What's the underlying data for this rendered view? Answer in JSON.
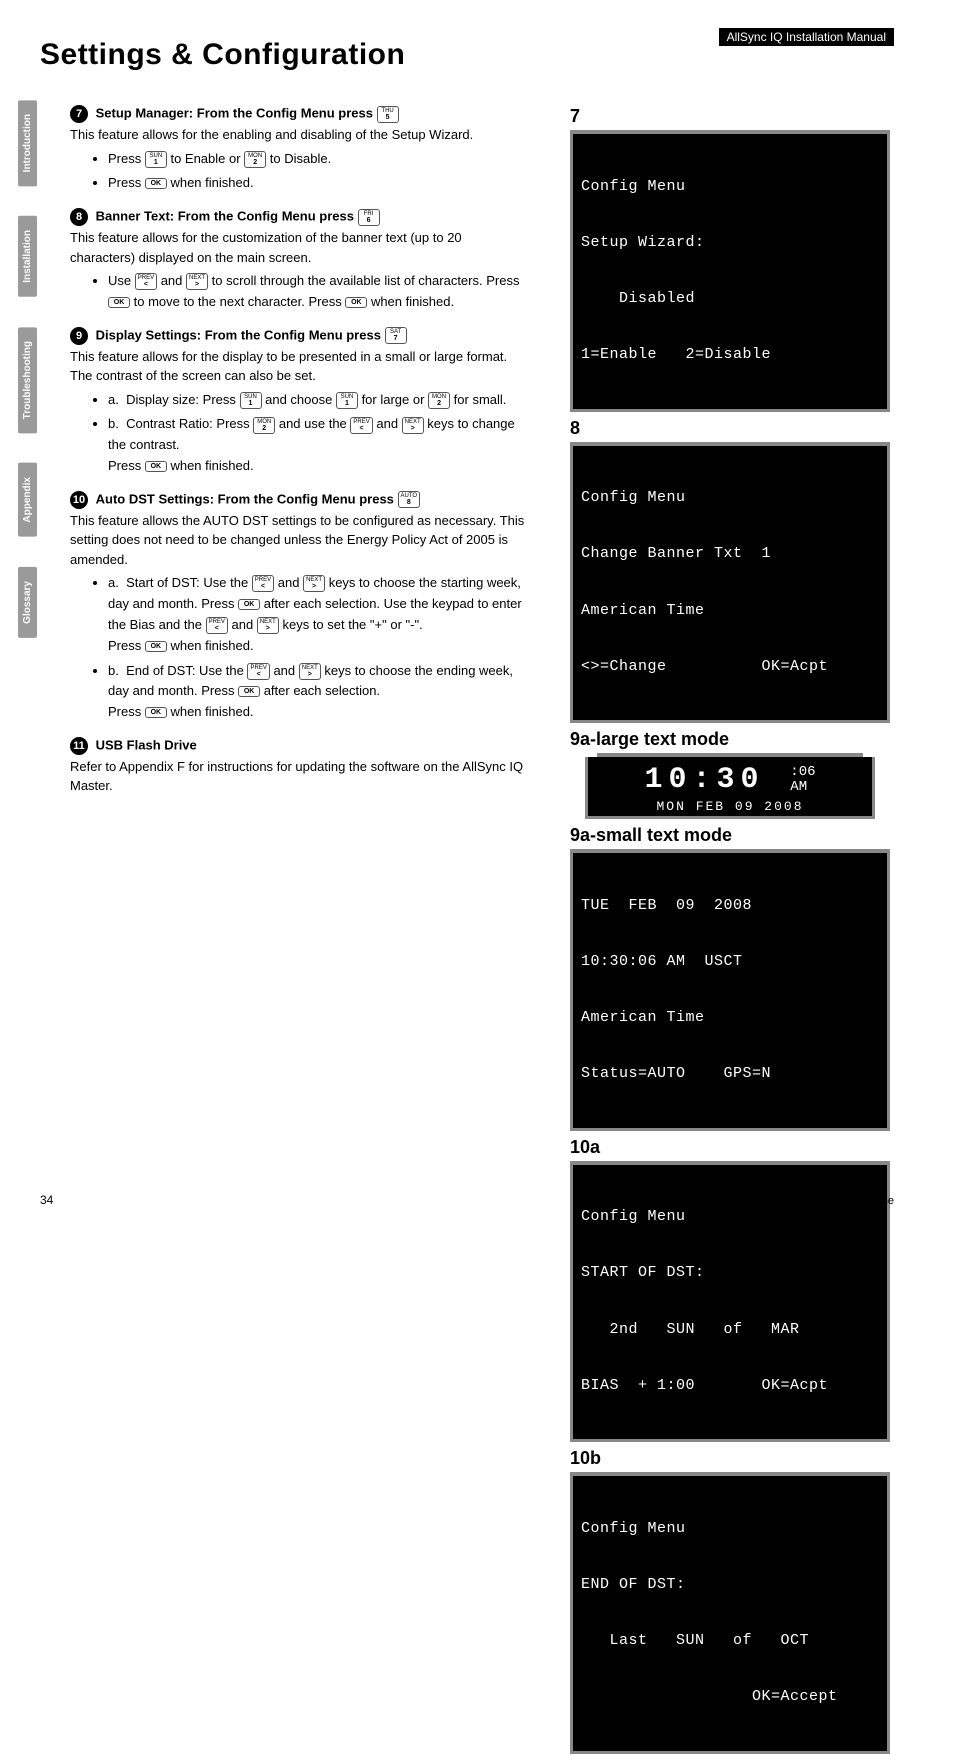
{
  "header_bar": "AllSync IQ Installation Manual",
  "page_title": "Settings & Configuration",
  "tabs": [
    "Introduction",
    "Installation",
    "Troubleshooting",
    "Appendix",
    "Glossary"
  ],
  "keys": {
    "thu5": {
      "top": "THU",
      "bot": "5"
    },
    "sun1": {
      "top": "SUN",
      "bot": "1"
    },
    "mon2": {
      "top": "MON",
      "bot": "2"
    },
    "ok": {
      "top": "",
      "bot": "OK"
    },
    "fri6": {
      "top": "FRI",
      "bot": "6"
    },
    "prev": {
      "top": "PREV",
      "bot": "<"
    },
    "next": {
      "top": "NEXT",
      "bot": ">"
    },
    "sat7": {
      "top": "SAT",
      "bot": "7"
    },
    "auto8": {
      "top": "AUTO",
      "bot": "8"
    }
  },
  "sections": {
    "s7": {
      "num": "7",
      "title": "Setup Manager: From the Config Menu press",
      "title_key": "thu5",
      "body": "This feature allows for the enabling and disabling of the Setup Wizard.",
      "bullets": [
        {
          "pre": "Press ",
          "k1": "sun1",
          "mid": " to Enable or ",
          "k2": "mon2",
          "post": " to Disable."
        },
        {
          "pre": "Press ",
          "k1": "ok",
          "post": " when finished."
        }
      ]
    },
    "s8": {
      "num": "8",
      "title": "Banner Text: From the Config Menu press",
      "title_key": "fri6",
      "body": "This feature allows for the customization of the banner text (up to 20 characters) displayed on the main screen.",
      "bullets": [
        {
          "pre": "Use ",
          "k1": "prev",
          "mid": " and ",
          "k2": "next",
          "post": " to scroll through the available list of characters. Press ",
          "k3": "ok",
          "post2": " to move to the next character. Press ",
          "k4": "ok",
          "post3": " when finished."
        }
      ]
    },
    "s9": {
      "num": "9",
      "title": "Display Settings: From the Config Menu press",
      "title_key": "sat7",
      "body": "This feature allows for the display to be presented in a small or large format. The contrast of the screen can also be set.",
      "bullets": [
        {
          "label": "a.",
          "pre": "Display size: Press ",
          "k1": "sun1",
          "mid": " and choose ",
          "k2": "sun1",
          "mid2": " for large or ",
          "k3": "mon2",
          "post": " for small."
        },
        {
          "label": "b.",
          "pre": "Contrast Ratio: Press ",
          "k1": "mon2",
          "mid": " and use the ",
          "k2": "prev",
          "mid2": " and ",
          "k3": "next",
          "post": " keys to change the contrast.",
          "after": "Press ",
          "k4": "ok",
          "after2": " when finished."
        }
      ]
    },
    "s10": {
      "num": "10",
      "title": "Auto DST Settings: From the Config Menu press",
      "title_key": "auto8",
      "body": "This feature allows the AUTO DST settings to be configured as necessary. This setting does not need to be changed unless the Energy Policy Act of 2005 is amended.",
      "bullets": [
        {
          "label": "a.",
          "pre": "Start of DST: Use the ",
          "k1": "prev",
          "mid": " and ",
          "k2": "next",
          "post": " keys to choose the starting week, day and month. Press ",
          "k3": "ok",
          "post2": " after each selection. Use the keypad to enter the Bias and the ",
          "k4": "prev",
          "post3": " and ",
          "k5": "next",
          "post4": " keys to set the \"+\" or \"-\".",
          "after": "Press ",
          "k6": "ok",
          "after2": " when finished."
        },
        {
          "label": "b.",
          "pre": "End of DST: Use the ",
          "k1": "prev",
          "mid": " and ",
          "k2": "next",
          "post": " keys to choose the ending week, day and month. Press ",
          "k3": "ok",
          "post2": " after each selection.",
          "after": "Press ",
          "k4": "ok",
          "after2": " when finished."
        }
      ]
    },
    "s11": {
      "num": "11",
      "title": "USB Flash Drive",
      "body": "Refer to Appendix F for instructions for updating the software on the AllSync IQ Master."
    }
  },
  "panels": {
    "p7": {
      "label": "7",
      "lines": [
        "Config Menu",
        "Setup Wizard:",
        "    Disabled",
        "1=Enable   2=Disable"
      ]
    },
    "p8": {
      "label": "8",
      "lines": [
        "Config Menu",
        "Change Banner Txt  1",
        "American Time",
        "<>=Change          OK=Acpt"
      ]
    },
    "p9a_large": {
      "label": "9a-large text mode",
      "big": "10:30",
      "side_top": ":06",
      "side_bot": "AM",
      "date": "MON FEB 09 2008"
    },
    "p9a_small": {
      "label": "9a-small text mode",
      "lines": [
        "TUE  FEB  09  2008",
        "10:30:06 AM  USCT",
        "American Time",
        "Status=AUTO    GPS=N"
      ]
    },
    "p10a": {
      "label": "10a",
      "lines": [
        "Config Menu",
        "START OF DST:",
        "   2nd   SUN   of   MAR",
        "BIAS  + 1:00       OK=Acpt"
      ]
    },
    "p10b": {
      "label": "10b",
      "lines": [
        "Config Menu",
        "END OF DST:",
        "   Last   SUN   of   OCT",
        "                  OK=Accept"
      ]
    }
  },
  "footer": {
    "left": "34",
    "right": "© American Time"
  }
}
